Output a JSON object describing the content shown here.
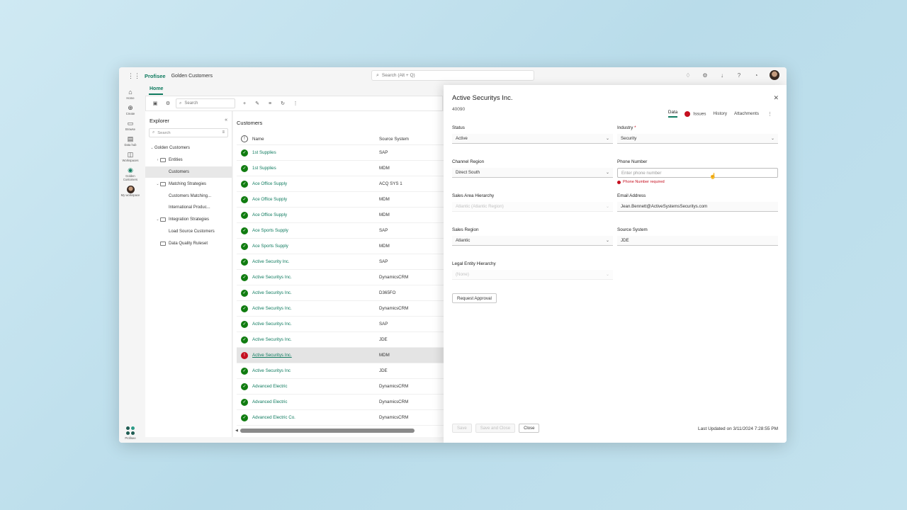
{
  "app": {
    "brand": "Profisee",
    "breadcrumb": "Golden Customers",
    "search_placeholder": "Search (Alt + Q)"
  },
  "topbar_icons": [
    "bell-icon",
    "gear-icon",
    "download-icon",
    "help-icon",
    "notification-icon"
  ],
  "rail": {
    "items": [
      {
        "label": "Home",
        "icon": "home-icon",
        "glyph": "⌂"
      },
      {
        "label": "Create",
        "icon": "plus-circle-icon",
        "glyph": "⊕"
      },
      {
        "label": "Browse",
        "icon": "folder-icon",
        "glyph": "▭"
      },
      {
        "label": "Data hub",
        "icon": "database-icon",
        "glyph": "▤"
      },
      {
        "label": "Workspaces",
        "icon": "workspaces-icon",
        "glyph": "◫"
      },
      {
        "label": "Golden Customers",
        "icon": "golden-customers-icon",
        "glyph": "◉"
      },
      {
        "label": "My workspace",
        "icon": "avatar",
        "glyph": ""
      }
    ],
    "bottom_label": "Profisee"
  },
  "home_tab": "Home",
  "toolbar": {
    "search_placeholder": "Search"
  },
  "explorer": {
    "title": "Explorer",
    "search_placeholder": "Search",
    "tree": [
      {
        "label": "Golden Customers",
        "level": 0,
        "chev": "⌄",
        "folder": false
      },
      {
        "label": "Entities",
        "level": 1,
        "chev": "›",
        "folder": true
      },
      {
        "label": "Customers",
        "level": 2,
        "chev": "",
        "folder": false,
        "selected": true
      },
      {
        "label": "Matching Strategies",
        "level": 1,
        "chev": "⌄",
        "folder": true
      },
      {
        "label": "Customers Matching...",
        "level": 2,
        "chev": "",
        "folder": false
      },
      {
        "label": "International Produc...",
        "level": 2,
        "chev": "",
        "folder": false
      },
      {
        "label": "Integration Strategies",
        "level": 1,
        "chev": "⌄",
        "folder": true
      },
      {
        "label": "Load Source Customers",
        "level": 2,
        "chev": "",
        "folder": false
      },
      {
        "label": "Data Quality Ruleset",
        "level": 1,
        "chev": "",
        "folder": true
      }
    ]
  },
  "grid": {
    "title": "Customers",
    "col_name": "Name",
    "col_source": "Source System",
    "rows": [
      {
        "name": "1st Supplies",
        "source": "SAP",
        "status": "ok"
      },
      {
        "name": "1st Supplies",
        "source": "MDM",
        "status": "ok"
      },
      {
        "name": "Ace Office Supply",
        "source": "ACQ SYS 1",
        "status": "ok"
      },
      {
        "name": "Ace Office Supply",
        "source": "MDM",
        "status": "ok"
      },
      {
        "name": "Ace Office Supply",
        "source": "MDM",
        "status": "ok"
      },
      {
        "name": "Ace Sports Supply",
        "source": "SAP",
        "status": "ok"
      },
      {
        "name": "Ace Sports Supply",
        "source": "MDM",
        "status": "ok"
      },
      {
        "name": "Active Security Inc.",
        "source": "SAP",
        "status": "ok"
      },
      {
        "name": "Active Securitys Inc.",
        "source": "DynamicsCRM",
        "status": "ok"
      },
      {
        "name": "Active Securitys Inc.",
        "source": "D365FO",
        "status": "ok"
      },
      {
        "name": "Active Securitys Inc.",
        "source": "DynamicsCRM",
        "status": "ok"
      },
      {
        "name": "Active Securitys Inc.",
        "source": "SAP",
        "status": "ok"
      },
      {
        "name": "Active Securitys Inc.",
        "source": "JDE",
        "status": "ok"
      },
      {
        "name": "Active Securitys Inc.",
        "source": "MDM",
        "status": "err",
        "highlight": true
      },
      {
        "name": "Active Securitys Inc",
        "source": "JDE",
        "status": "ok"
      },
      {
        "name": "Advanced Electric",
        "source": "DynamicsCRM",
        "status": "ok"
      },
      {
        "name": "Advanced Electric",
        "source": "DynamicsCRM",
        "status": "ok"
      },
      {
        "name": "Advanced Electric Co.",
        "source": "DynamicsCRM",
        "status": "ok"
      }
    ]
  },
  "panel": {
    "title": "Active Securitys Inc.",
    "id": "40090",
    "tabs": {
      "data": "Data",
      "issues": "Issues",
      "history": "History",
      "attachments": "Attachments"
    },
    "fields": {
      "status": {
        "label": "Status",
        "value": "Active"
      },
      "industry": {
        "label": "Industry",
        "required": "*",
        "value": "Security"
      },
      "channel_region": {
        "label": "Channel Region",
        "value": "Direct South"
      },
      "phone_number": {
        "label": "Phone Number",
        "placeholder": "Enter phone number",
        "error": "Phone Number required"
      },
      "sales_area_hierarchy": {
        "label": "Sales Area Hierarchy",
        "value": "Atlantic (Atlantic Region)"
      },
      "email_address": {
        "label": "Email Address",
        "value": "Jean.Bennett@ActiveSystemsSecuritys.com"
      },
      "sales_region": {
        "label": "Sales Region",
        "value": "Atlantic"
      },
      "source_system": {
        "label": "Source System",
        "value": "JDE"
      },
      "legal_entity_hierarchy": {
        "label": "Legal Entity Hierarchy",
        "value": "(None)"
      }
    },
    "request_approval": "Request Approval",
    "footer": {
      "save": "Save",
      "save_and_close": "Save and Close",
      "close": "Close"
    },
    "last_updated": "Last Updated on 3/11/2024 7:28:55 PM"
  },
  "colors": {
    "brand": "#0f7b5f",
    "ok": "#107c10",
    "error": "#c50f1f"
  }
}
